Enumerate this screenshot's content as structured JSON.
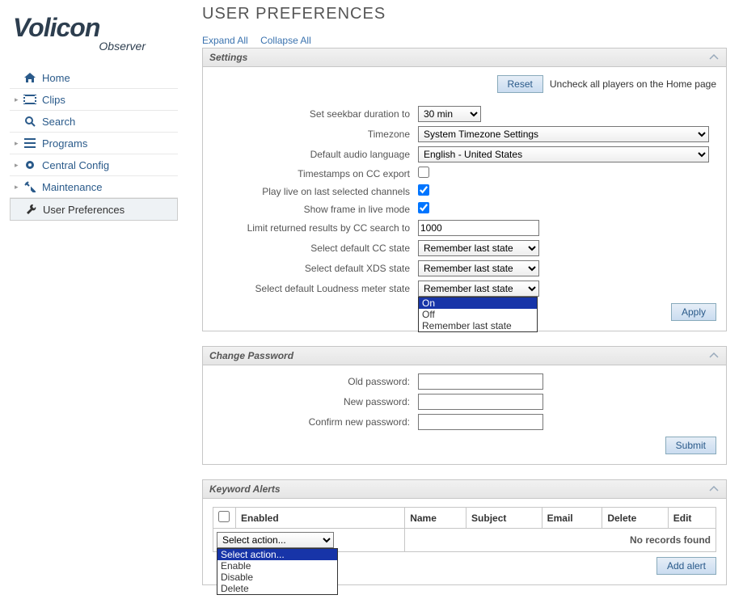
{
  "brand": {
    "name": "Volicon",
    "sub": "Observer"
  },
  "nav": [
    {
      "label": "Home",
      "icon": "home"
    },
    {
      "label": "Clips",
      "icon": "clips"
    },
    {
      "label": "Search",
      "icon": "search"
    },
    {
      "label": "Programs",
      "icon": "programs"
    },
    {
      "label": "Central Config",
      "icon": "gear"
    },
    {
      "label": "Maintenance",
      "icon": "tools"
    },
    {
      "label": "User Preferences",
      "icon": "wrench"
    }
  ],
  "page_title": "USER PREFERENCES",
  "tools": {
    "expand": "Expand All",
    "collapse": "Collapse All"
  },
  "settings": {
    "title": "Settings",
    "reset": "Reset",
    "reset_hint": "Uncheck all players on the Home page",
    "seekbar_label": "Set seekbar duration to",
    "seekbar_value": "30 min",
    "timezone_label": "Timezone",
    "timezone_value": "System Timezone Settings",
    "audio_label": "Default audio language",
    "audio_value": "English - United States",
    "ts_label": "Timestamps on CC export",
    "ts_checked": false,
    "playlive_label": "Play live on last selected channels",
    "playlive_checked": true,
    "frame_label": "Show frame in live mode",
    "frame_checked": true,
    "limit_label": "Limit returned results by CC search to",
    "limit_value": "1000",
    "cc_label": "Select default CC state",
    "cc_value": "Remember last state",
    "xds_label": "Select default XDS state",
    "xds_value": "Remember last state",
    "loud_label": "Select default Loudness meter state",
    "loud_value": "Remember last state",
    "loud_options": [
      "On",
      "Off",
      "Remember last state"
    ],
    "apply": "Apply"
  },
  "password": {
    "title": "Change Password",
    "old": "Old password:",
    "new": "New password:",
    "confirm": "Confirm new password:",
    "submit": "Submit"
  },
  "keyword": {
    "title": "Keyword Alerts",
    "cols": [
      "",
      "Enabled",
      "Name",
      "Subject",
      "Email",
      "Delete",
      "Edit"
    ],
    "no_records": "No records found",
    "action_value": "Select action...",
    "actions": [
      "Select action...",
      "Enable",
      "Disable",
      "Delete"
    ],
    "add": "Add alert"
  }
}
